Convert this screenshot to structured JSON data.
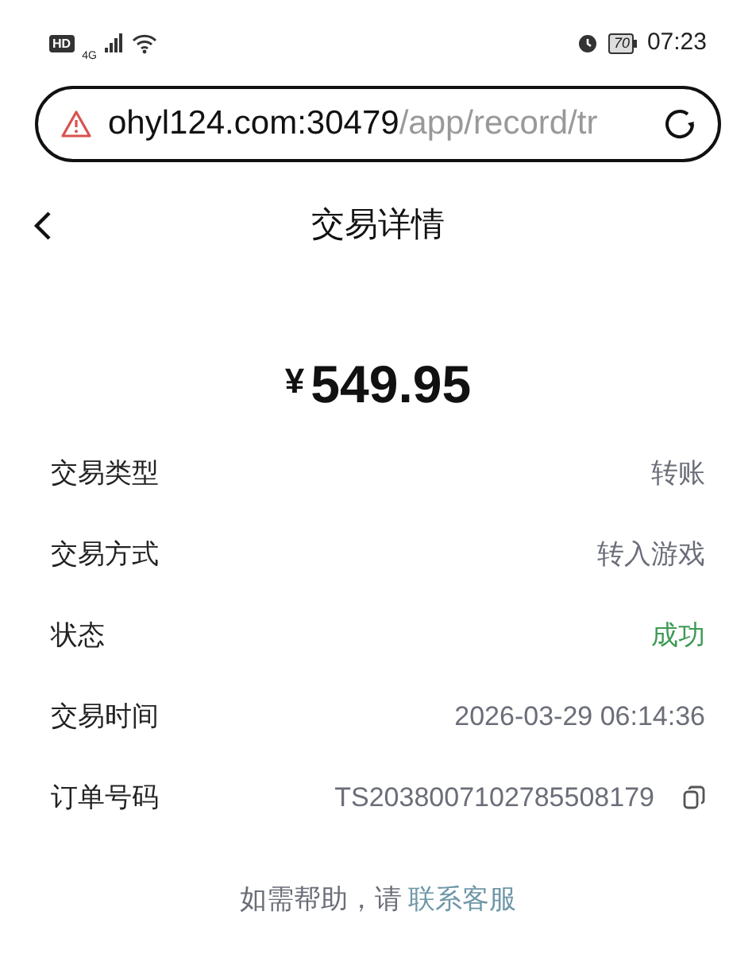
{
  "status_bar": {
    "hd": "HD",
    "network": "4G",
    "battery": "70",
    "time": "07:23"
  },
  "address_bar": {
    "host": "ohyl124.com:30479",
    "path": "/app/record/tr",
    "insecure": true
  },
  "header": {
    "title": "交易详情"
  },
  "amount": {
    "currency": "¥",
    "value": "549.95"
  },
  "details": [
    {
      "label": "交易类型",
      "value": "转账",
      "kind": "plain"
    },
    {
      "label": "交易方式",
      "value": "转入游戏",
      "kind": "plain"
    },
    {
      "label": "状态",
      "value": "成功",
      "kind": "success"
    },
    {
      "label": "交易时间",
      "value": "2026-03-29 06:14:36",
      "kind": "plain"
    },
    {
      "label": "订单号码",
      "value": "TS2038007102785508179",
      "kind": "copyable"
    }
  ],
  "help": {
    "text": "如需帮助，请",
    "link": "联系客服"
  }
}
